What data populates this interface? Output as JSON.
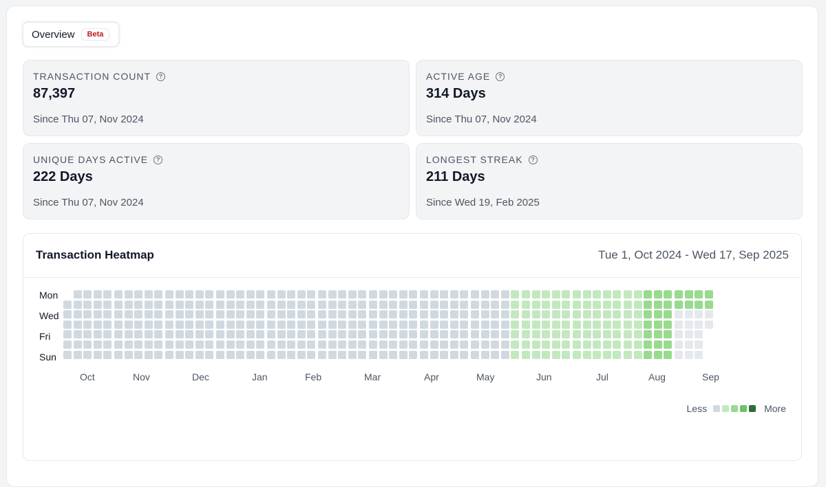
{
  "tabs": {
    "overview_label": "Overview",
    "beta_badge": "Beta"
  },
  "stats": [
    {
      "label": "TRANSACTION COUNT",
      "value": "87,397",
      "sub": "Since Thu 07, Nov 2024"
    },
    {
      "label": "ACTIVE AGE",
      "value": "314 Days",
      "sub": "Since Thu 07, Nov 2024"
    },
    {
      "label": "UNIQUE DAYS ACTIVE",
      "value": "222 Days",
      "sub": "Since Thu 07, Nov 2024"
    },
    {
      "label": "LONGEST STREAK",
      "value": "211 Days",
      "sub": "Since Wed 19, Feb 2025"
    }
  ],
  "heatmap": {
    "title": "Transaction Heatmap",
    "range": "Tue 1, Oct 2024 - Wed 17, Sep 2025",
    "day_labels": [
      "Mon",
      "Wed",
      "Fri",
      "Sun"
    ],
    "months": [
      "Oct",
      "Nov",
      "Dec",
      "Jan",
      "Feb",
      "Mar",
      "Apr",
      "May",
      "Jun",
      "Jul",
      "Aug",
      "Sep"
    ],
    "legend_less": "Less",
    "legend_more": "More",
    "colors": [
      "#e5e9ed",
      "#d1d9e0",
      "#c3e8bf",
      "#98da8e",
      "#6cc267",
      "#3f9a45",
      "#2e6d36"
    ]
  }
}
